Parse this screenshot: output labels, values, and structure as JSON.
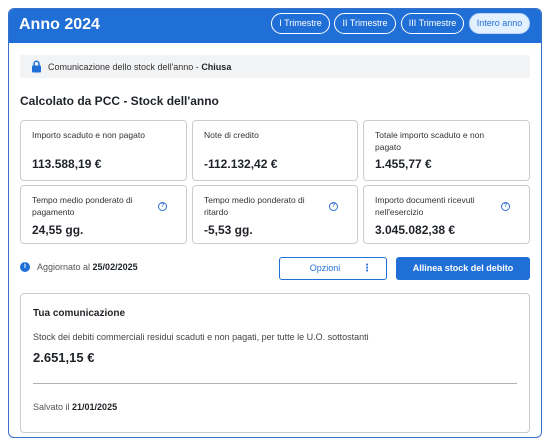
{
  "header": {
    "title": "Anno 2024",
    "tabs": [
      {
        "label": "I Trimestre",
        "active": false
      },
      {
        "label": "II Trimestre",
        "active": false
      },
      {
        "label": "III Trimestre",
        "active": false
      },
      {
        "label": "Intero anno",
        "active": true
      }
    ]
  },
  "status_bar": {
    "icon": "lock-icon",
    "text": "Comunicazione dello stock dell'anno - ",
    "status": "Chiusa"
  },
  "section_title": "Calcolato da PCC - Stock dell'anno",
  "cards": [
    {
      "label": "Importo scaduto e non pagato",
      "value": "113.588,19 €",
      "info": false
    },
    {
      "label": "Note di credito",
      "value": "-112.132,42 €",
      "info": false
    },
    {
      "label": "Totale importo scaduto e non pagato",
      "value": "1.455,77 €",
      "info": false
    },
    {
      "label": "Tempo medio ponderato di pagamento",
      "value": "24,55 gg.",
      "info": true
    },
    {
      "label": "Tempo medio ponderato di ritardo",
      "value": "-5,53 gg.",
      "info": true
    },
    {
      "label": "Importo documenti ricevuti nell'esercizio",
      "value": "3.045.082,38 €",
      "info": true
    }
  ],
  "updated": {
    "prefix": "Aggiornato al ",
    "date": "25/02/2025"
  },
  "buttons": {
    "options_label": "Opzioni",
    "options_icon": "⋮",
    "align_label": "Allinea stock del debito"
  },
  "communication": {
    "title": "Tua comunicazione",
    "description": "Stock dei debiti commerciali residui scaduti e non pagati, per tutte le U.O. sottostanti",
    "value": "2.651,15 €",
    "saved_prefix": "Salvato il ",
    "saved_date": "21/01/2025"
  },
  "colors": {
    "primary": "#1f6fd6",
    "border": "#c9ccd1"
  }
}
